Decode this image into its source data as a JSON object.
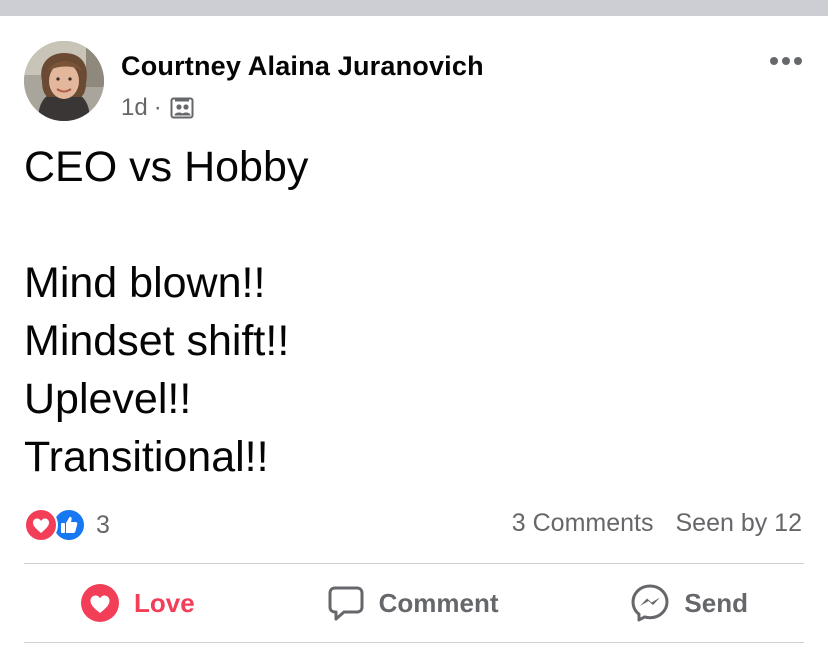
{
  "post": {
    "author": "Courtney Alaina Juranovich",
    "time": "1d",
    "separator": "·",
    "audience_icon": "group-icon",
    "more_icon": "more-dots-icon",
    "text_lines": [
      "CEO vs Hobby",
      "",
      "Mind blown!!",
      "Mindset shift!!",
      "Uplevel!!",
      "Transitional!!"
    ]
  },
  "stats": {
    "reaction_icons": [
      "love-reaction-icon",
      "like-reaction-icon"
    ],
    "reaction_count": "3",
    "comments": "3 Comments",
    "seen_by": "Seen by 12"
  },
  "actions": {
    "love_label": "Love",
    "comment_label": "Comment",
    "send_label": "Send"
  },
  "colors": {
    "love": "#f33e58",
    "like": "#1877f2",
    "secondary_text": "#65676b",
    "divider": "#ced0d4",
    "top_bar": "#ccced4"
  }
}
